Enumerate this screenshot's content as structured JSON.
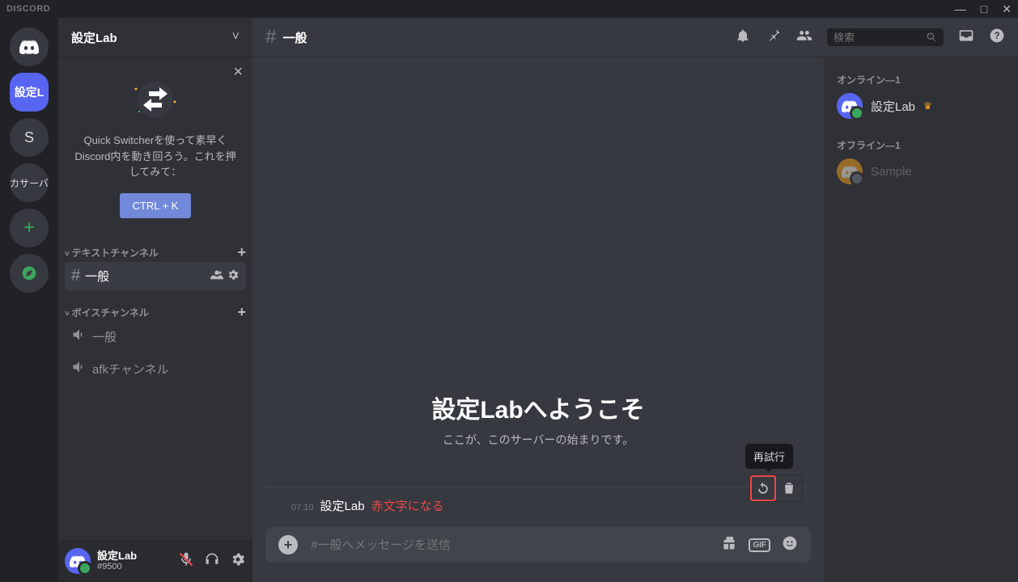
{
  "titlebar": {
    "app": "DISCORD"
  },
  "guilds": {
    "active_label": "設定L",
    "s_label": "S",
    "add_server_label": "カサーバ"
  },
  "server": {
    "name": "設定Lab",
    "qs_text": "Quick Switcherを使って素早くDiscord内を動き回ろう。これを押してみて：",
    "qs_key": "CTRL + K"
  },
  "channels": {
    "text_category": "テキストチャンネル",
    "voice_category": "ボイスチャンネル",
    "text": [
      {
        "name": "一般",
        "selected": true
      }
    ],
    "voice": [
      {
        "name": "一般"
      },
      {
        "name": "afkチャンネル"
      }
    ]
  },
  "user": {
    "name": "設定Lab",
    "tag": "#9500"
  },
  "header": {
    "channel": "一般",
    "search_placeholder": "検索"
  },
  "chat": {
    "welcome_title": "設定Labへようこそ",
    "welcome_sub": "ここが、このサーバーの始まりです。",
    "message": {
      "time": "07:10",
      "author": "設定Lab",
      "text": "赤文字になる"
    },
    "tooltip_retry": "再試行",
    "input_placeholder": "#一般へメッセージを送信"
  },
  "members": {
    "online_header": "オンライン—1",
    "offline_header": "オフライン—1",
    "online": [
      {
        "name": "設定Lab",
        "owner": true
      }
    ],
    "offline": [
      {
        "name": "Sample"
      }
    ]
  }
}
